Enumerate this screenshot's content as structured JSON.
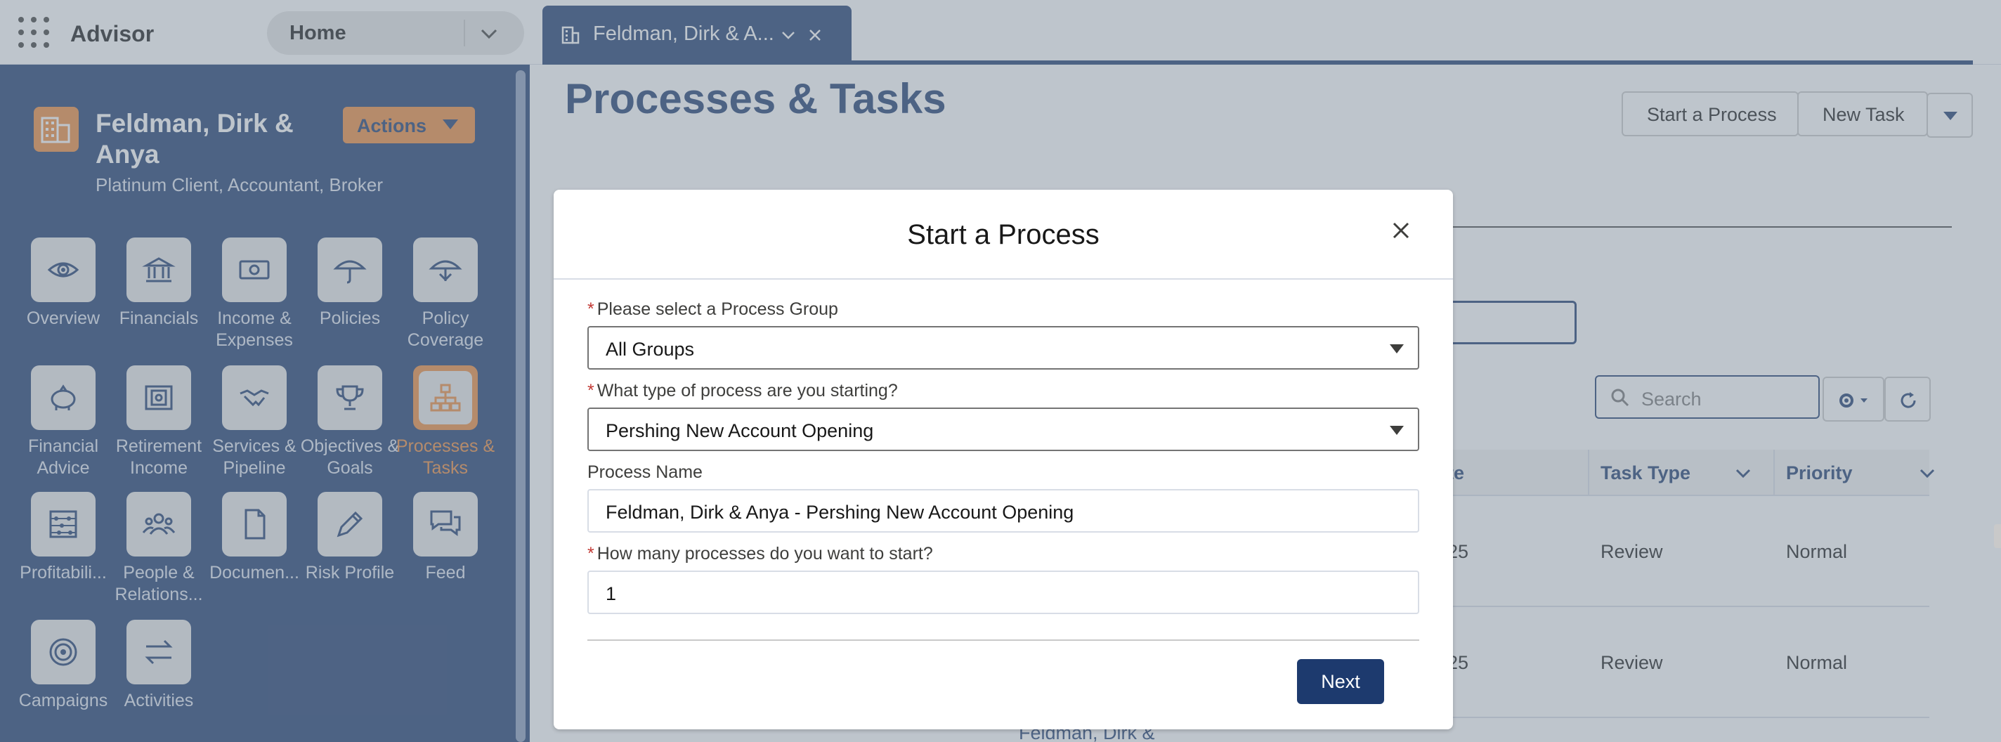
{
  "app": {
    "name": "Advisor"
  },
  "nav": {
    "selected": "Home"
  },
  "tab": {
    "label": "Feldman, Dirk & A..."
  },
  "account": {
    "name": "Feldman, Dirk & Anya",
    "subtitle": "Platinum Client, Accountant, Broker",
    "actions_label": "Actions"
  },
  "sidebar": {
    "items": [
      {
        "label": "Overview",
        "icon": "eye-icon"
      },
      {
        "label": "Financials",
        "icon": "bank-icon"
      },
      {
        "label": "Income & Expenses",
        "icon": "money-icon"
      },
      {
        "label": "Policies",
        "icon": "umbrella-icon"
      },
      {
        "label": "Policy Coverage",
        "icon": "umbrella-coverage-icon"
      },
      {
        "label": "Financial Advice",
        "icon": "piggy-bank-icon"
      },
      {
        "label": "Retirement Income",
        "icon": "safe-icon"
      },
      {
        "label": "Services & Pipeline",
        "icon": "handshake-icon"
      },
      {
        "label": "Objectives & Goals",
        "icon": "trophy-icon"
      },
      {
        "label": "Processes & Tasks",
        "icon": "hierarchy-icon"
      },
      {
        "label": "Profitabili...",
        "icon": "abacus-icon"
      },
      {
        "label": "People & Relations...",
        "icon": "people-icon"
      },
      {
        "label": "Documen...",
        "icon": "document-icon"
      },
      {
        "label": "Risk Profile",
        "icon": "pencil-icon"
      },
      {
        "label": "Feed",
        "icon": "chat-icon"
      },
      {
        "label": "Campaigns",
        "icon": "target-icon"
      },
      {
        "label": "Activities",
        "icon": "arrows-icon"
      }
    ]
  },
  "page": {
    "title": "Processes & Tasks",
    "start_process_label": "Start a Process",
    "new_task_label": "New Task",
    "search_placeholder": "Search"
  },
  "table": {
    "columns": {
      "date_partial": "te",
      "task_type": "Task Type",
      "priority": "Priority"
    },
    "rows": [
      {
        "date_partial": "25",
        "task_type": "Review",
        "priority": "Normal"
      },
      {
        "date_partial": "25",
        "task_type": "Review",
        "priority": "Normal"
      }
    ],
    "partial_owner": "Feldman, Dirk &"
  },
  "modal": {
    "title": "Start a Process",
    "group_label": "Please select a Process Group",
    "group_value": "All Groups",
    "type_label": "What type of process are you starting?",
    "type_value": "Pershing New Account Opening",
    "name_label": "Process Name",
    "name_value": "Feldman, Dirk & Anya - Pershing New Account Opening",
    "count_label": "How many processes do you want to start?",
    "count_value": "1",
    "next_label": "Next",
    "required_mark": "*"
  },
  "colors": {
    "brand": "#1d3a6e",
    "accent": "#ed8b3c",
    "required": "#c23934"
  }
}
